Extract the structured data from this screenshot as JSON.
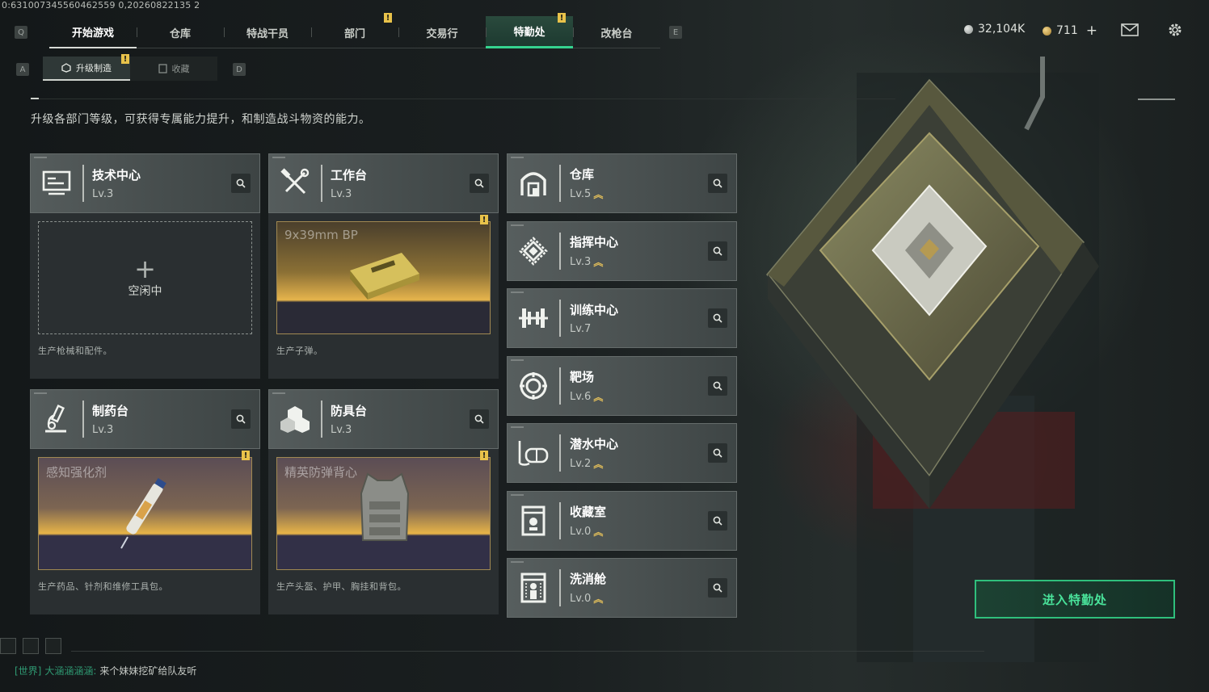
{
  "build_id": "0:631007345560462559 0,20260822135 2",
  "nav": {
    "left_key": "Q",
    "right_key": "E",
    "tabs": [
      {
        "label": "开始游戏"
      },
      {
        "label": "仓库"
      },
      {
        "label": "特战干员"
      },
      {
        "label": "部门"
      },
      {
        "label": "交易行"
      },
      {
        "label": "特勤处"
      },
      {
        "label": "改枪台"
      }
    ],
    "active_tab": "特勤处"
  },
  "currency": {
    "coins": "32,104K",
    "bonds": "711",
    "add": "+"
  },
  "subnav": {
    "left_key": "A",
    "right_key": "D",
    "tabs": [
      {
        "label": "升级制造"
      },
      {
        "label": "收藏"
      }
    ]
  },
  "description": "升级各部门等级，可获得专属能力提升，和制造战斗物资的能力。",
  "cards": [
    {
      "name": "技术中心",
      "level": "Lv.3",
      "icon": "tech-monitor-icon",
      "status": "空闲中",
      "note": "生产枪械和配件。"
    },
    {
      "name": "工作台",
      "level": "Lv.3",
      "icon": "tools-icon",
      "product": "9x39mm BP",
      "note": "生产子弹。"
    },
    {
      "name": "制药台",
      "level": "Lv.3",
      "icon": "microscope-icon",
      "product": "感知强化剂",
      "note": "生产药品、针剂和维修工具包。"
    },
    {
      "name": "防具台",
      "level": "Lv.3",
      "icon": "boxes-icon",
      "product": "精英防弹背心",
      "note": "生产头盔、护甲、胸挂和背包。"
    }
  ],
  "departments": [
    {
      "name": "仓库",
      "level": "Lv.5",
      "upgradable": true,
      "icon": "warehouse-icon"
    },
    {
      "name": "指挥中心",
      "level": "Lv.3",
      "upgradable": true,
      "icon": "command-chip-icon"
    },
    {
      "name": "训练中心",
      "level": "Lv.7",
      "upgradable": false,
      "icon": "dumbbell-icon"
    },
    {
      "name": "靶场",
      "level": "Lv.6",
      "upgradable": true,
      "icon": "target-icon"
    },
    {
      "name": "潜水中心",
      "level": "Lv.2",
      "upgradable": true,
      "icon": "diving-mask-icon"
    },
    {
      "name": "收藏室",
      "level": "Lv.0",
      "upgradable": true,
      "icon": "display-case-icon"
    },
    {
      "name": "洗消舱",
      "level": "Lv.0",
      "upgradable": true,
      "icon": "decon-chamber-icon"
    }
  ],
  "enter_button": "进入特勤处",
  "chat": {
    "channel": "[世界]",
    "sender": "大涵涵涵涵:",
    "message": "来个妹妹挖矿给队友听"
  },
  "colors": {
    "accent_green": "#35d38f",
    "gold": "#e3bf5a",
    "notice": "#e8c24a"
  }
}
